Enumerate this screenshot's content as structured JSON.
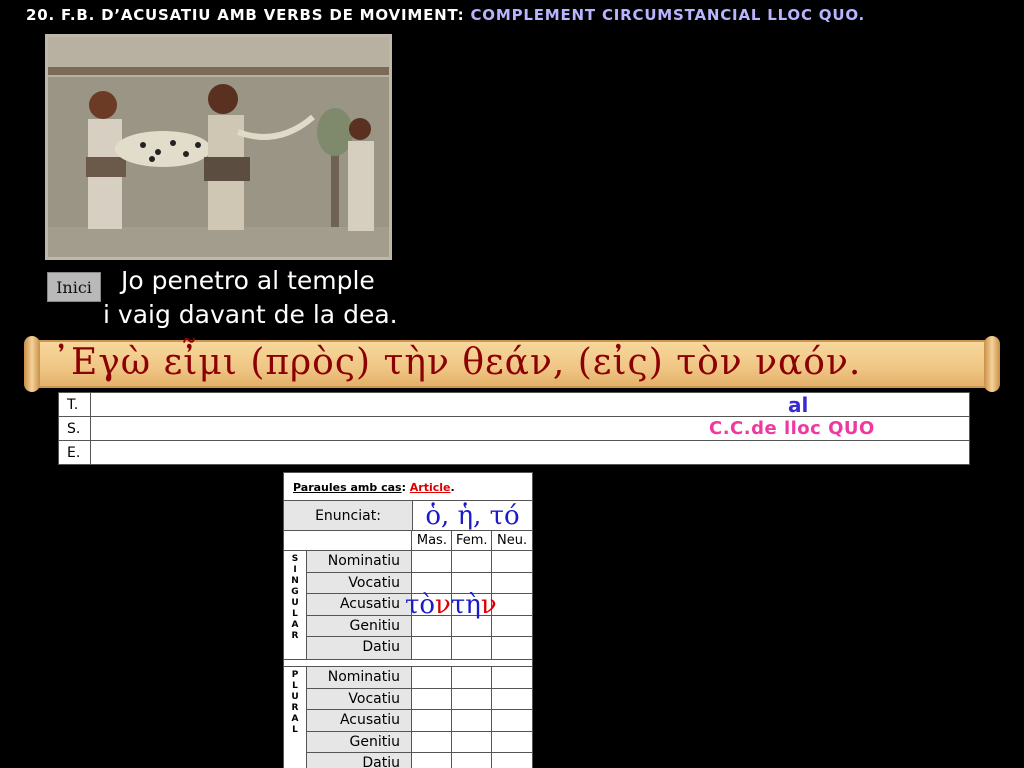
{
  "title": {
    "lead": "20. F.B. D’ACUSATIU AMB VERBS DE MOVIMENT: ",
    "accent": "COMPLEMENT CIRCUMSTANCIAL LLOC QUO."
  },
  "inici_button": "Inici",
  "translation": {
    "line1": "Jo penetro al temple",
    "line2": "i vaig davant de la dea."
  },
  "greek_sentence": "᾿Εγὼ  εἶμι  (πρὸς)  τὴν  θεάν,  (εἰς)  τὸν  ναόν.",
  "analysis": {
    "rows": [
      {
        "label": "T.",
        "value": "al"
      },
      {
        "label": "S.",
        "value": "C.C.de lloc QUO"
      },
      {
        "label": "E.",
        "value": ""
      }
    ]
  },
  "declension": {
    "header_prefix": "Paraules amb cas",
    "header_sep": ": ",
    "header_word": "Article",
    "header_end": ".",
    "enunciat_label": "Enunciat:",
    "enunciat_value": "ὁ, ἡ, τό",
    "genders": [
      "Mas.",
      "Fem.",
      "Neu."
    ],
    "singular_label": [
      "S",
      "I",
      "N",
      "G",
      "U",
      "L",
      "A",
      "R"
    ],
    "plural_label": [
      "P",
      "L",
      "U",
      "R",
      "A",
      "L"
    ],
    "cases": [
      "Nominatiu",
      "Vocatiu",
      "Acusatiu",
      "Genitiu",
      "Datiu"
    ],
    "acusatiu_singular": {
      "mas_stem": "τὸ",
      "mas_end": "ν",
      "fem_stem": "τὴ",
      "fem_end": "ν"
    }
  },
  "colors": {
    "accent_title": "#b9b4ff",
    "t_value": "#3a2ad1",
    "s_value": "#ee3aa0",
    "greek_blue": "#1a1ac8",
    "greek_red": "#d00",
    "scroll_text": "#8b0000"
  },
  "icons": {
    "image": "minoan-fresco-image"
  }
}
